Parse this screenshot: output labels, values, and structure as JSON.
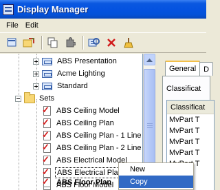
{
  "window": {
    "title": "Display Manager"
  },
  "menu": {
    "file": "File",
    "edit": "Edit"
  },
  "toolbar": {
    "icons": [
      "new-icon",
      "open-icon",
      "copy-icon",
      "puzzle-icon",
      "edit-settings-icon",
      "delete-icon",
      "purge-icon"
    ]
  },
  "tree": {
    "representations": [
      {
        "label": "ABS Presentation"
      },
      {
        "label": "Acme Lighting"
      },
      {
        "label": "Standard"
      }
    ],
    "sets_label": "Sets",
    "sets": [
      {
        "label": "ABS Ceiling Model"
      },
      {
        "label": "ABS Ceiling Plan"
      },
      {
        "label": "ABS Ceiling Plan - 1 Line"
      },
      {
        "label": "ABS Ceiling Plan - 2 Line"
      },
      {
        "label": "ABS Electrical Model"
      },
      {
        "label": "ABS Electrical Plan"
      },
      {
        "label": "ABS Floor Model"
      },
      {
        "label": "ABS Floor Plan"
      }
    ]
  },
  "panel": {
    "tabs": [
      "General",
      "D"
    ],
    "classification_label": "Classificat",
    "list_header": "Classificat",
    "rows": [
      "MvPart T",
      "MvPart T",
      "MvPart T",
      "MvPart T",
      "MvPart T"
    ]
  },
  "context_menu": {
    "items": [
      "New",
      "Copy"
    ]
  }
}
